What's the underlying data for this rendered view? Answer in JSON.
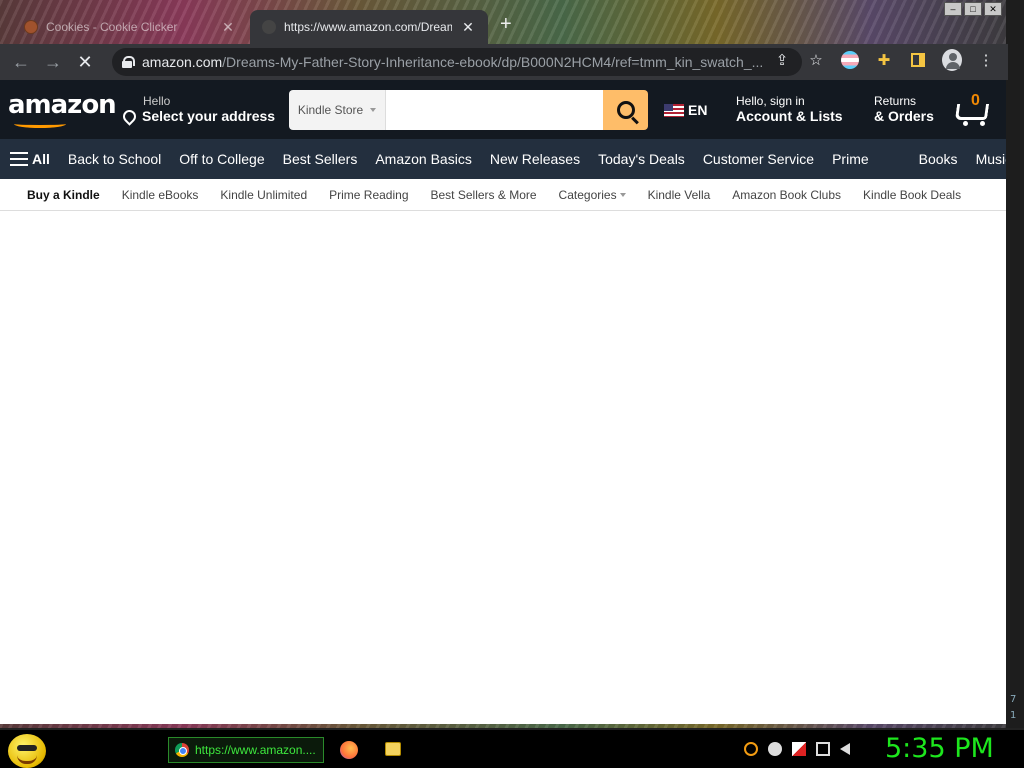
{
  "browser": {
    "tabs": [
      {
        "title": "Cookies - Cookie Clicker",
        "active": false
      },
      {
        "title": "https://www.amazon.com/Dream",
        "active": true
      }
    ],
    "new_tab_label": "+",
    "url_domain": "amazon.com",
    "url_path": "/Dreams-My-Father-Story-Inheritance-ebook/dp/B000N2HCM4/ref=tmm_kin_swatch_..."
  },
  "amazon": {
    "logo_text": "amazon",
    "deliver_small": "Hello",
    "deliver_big": "Select your address",
    "search_category": "Kindle Store",
    "search_value": "",
    "lang": "EN",
    "account_small": "Hello, sign in",
    "account_big": "Account & Lists",
    "returns_small": "Returns",
    "returns_big": "& Orders",
    "cart_count": "0",
    "nav_all": "All",
    "nav_items": [
      "Back to School",
      "Off to College",
      "Best Sellers",
      "Amazon Basics",
      "New Releases",
      "Today's Deals",
      "Customer Service",
      "Prime",
      "Books",
      "Music"
    ],
    "subnav_items": [
      "Buy a Kindle",
      "Kindle eBooks",
      "Kindle Unlimited",
      "Prime Reading",
      "Best Sellers & More",
      "Categories",
      "Kindle Vella",
      "Amazon Book Clubs",
      "Kindle Book Deals"
    ]
  },
  "taskbar": {
    "chrome_task_label": "https://www.amazon....",
    "clock": "5:35 PM"
  },
  "desktop_edge": {
    "digit_a": "7",
    "digit_b": "1"
  }
}
